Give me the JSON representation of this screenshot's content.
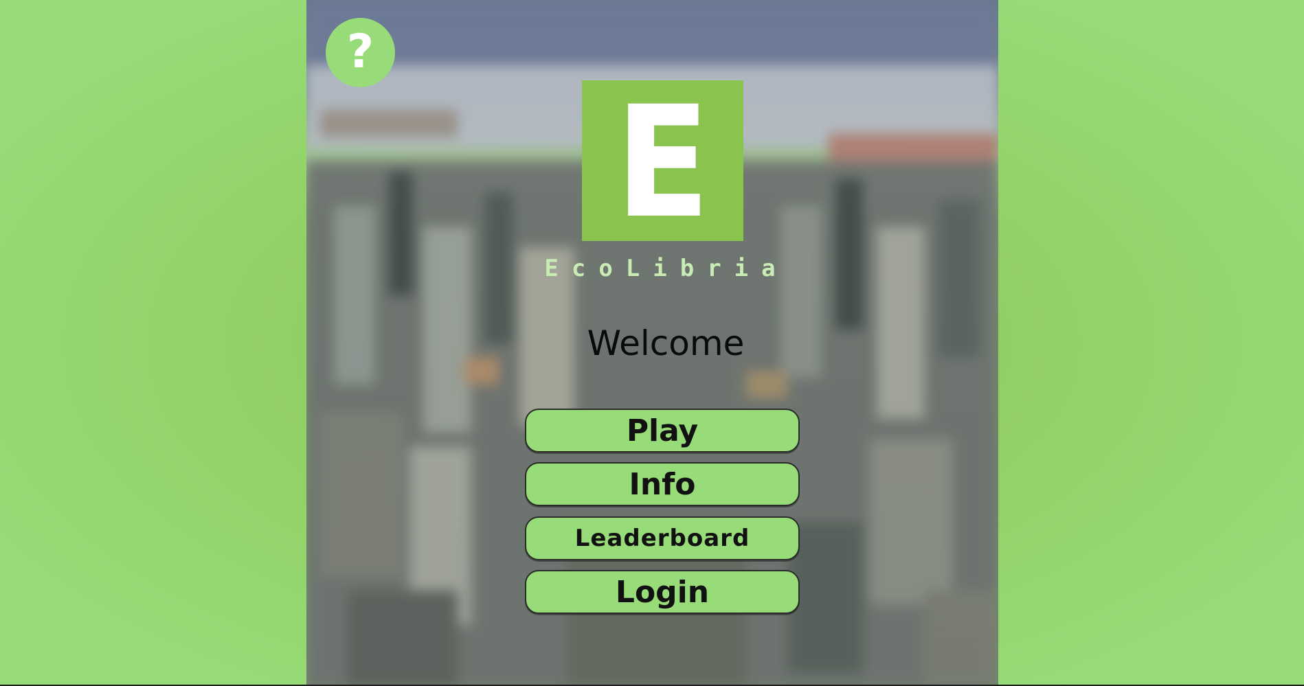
{
  "help": {
    "icon": "question-mark-icon",
    "glyph": "?"
  },
  "logo": {
    "letter": "E",
    "color": "#8bc34f"
  },
  "brand": {
    "name": "EcoLibria"
  },
  "welcome": {
    "text": "Welcome"
  },
  "menu": {
    "play": "Play",
    "info": "Info",
    "leaderboard": "Leaderboard",
    "login": "Login"
  },
  "theme": {
    "accent": "#97dc78",
    "background_green": "#8cc553"
  }
}
